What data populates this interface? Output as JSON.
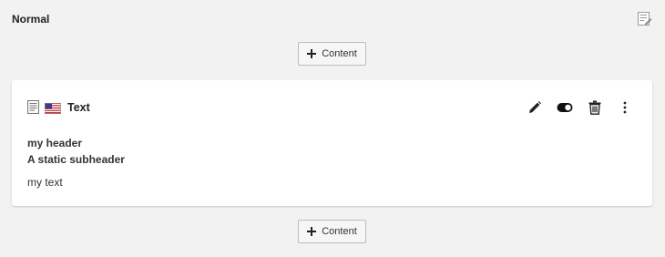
{
  "column": {
    "title": "Normal"
  },
  "add_content": {
    "label": "Content"
  },
  "element": {
    "type_label": "Text",
    "language_icon": "us-flag-icon",
    "header": "my header",
    "subheader": "A static subheader",
    "bodytext": "my text",
    "actions": [
      "edit",
      "hide",
      "delete",
      "more"
    ]
  },
  "colors": {
    "page_bg": "#f2f2f2",
    "card_bg": "#ffffff",
    "button_border": "#bcbcbc"
  }
}
